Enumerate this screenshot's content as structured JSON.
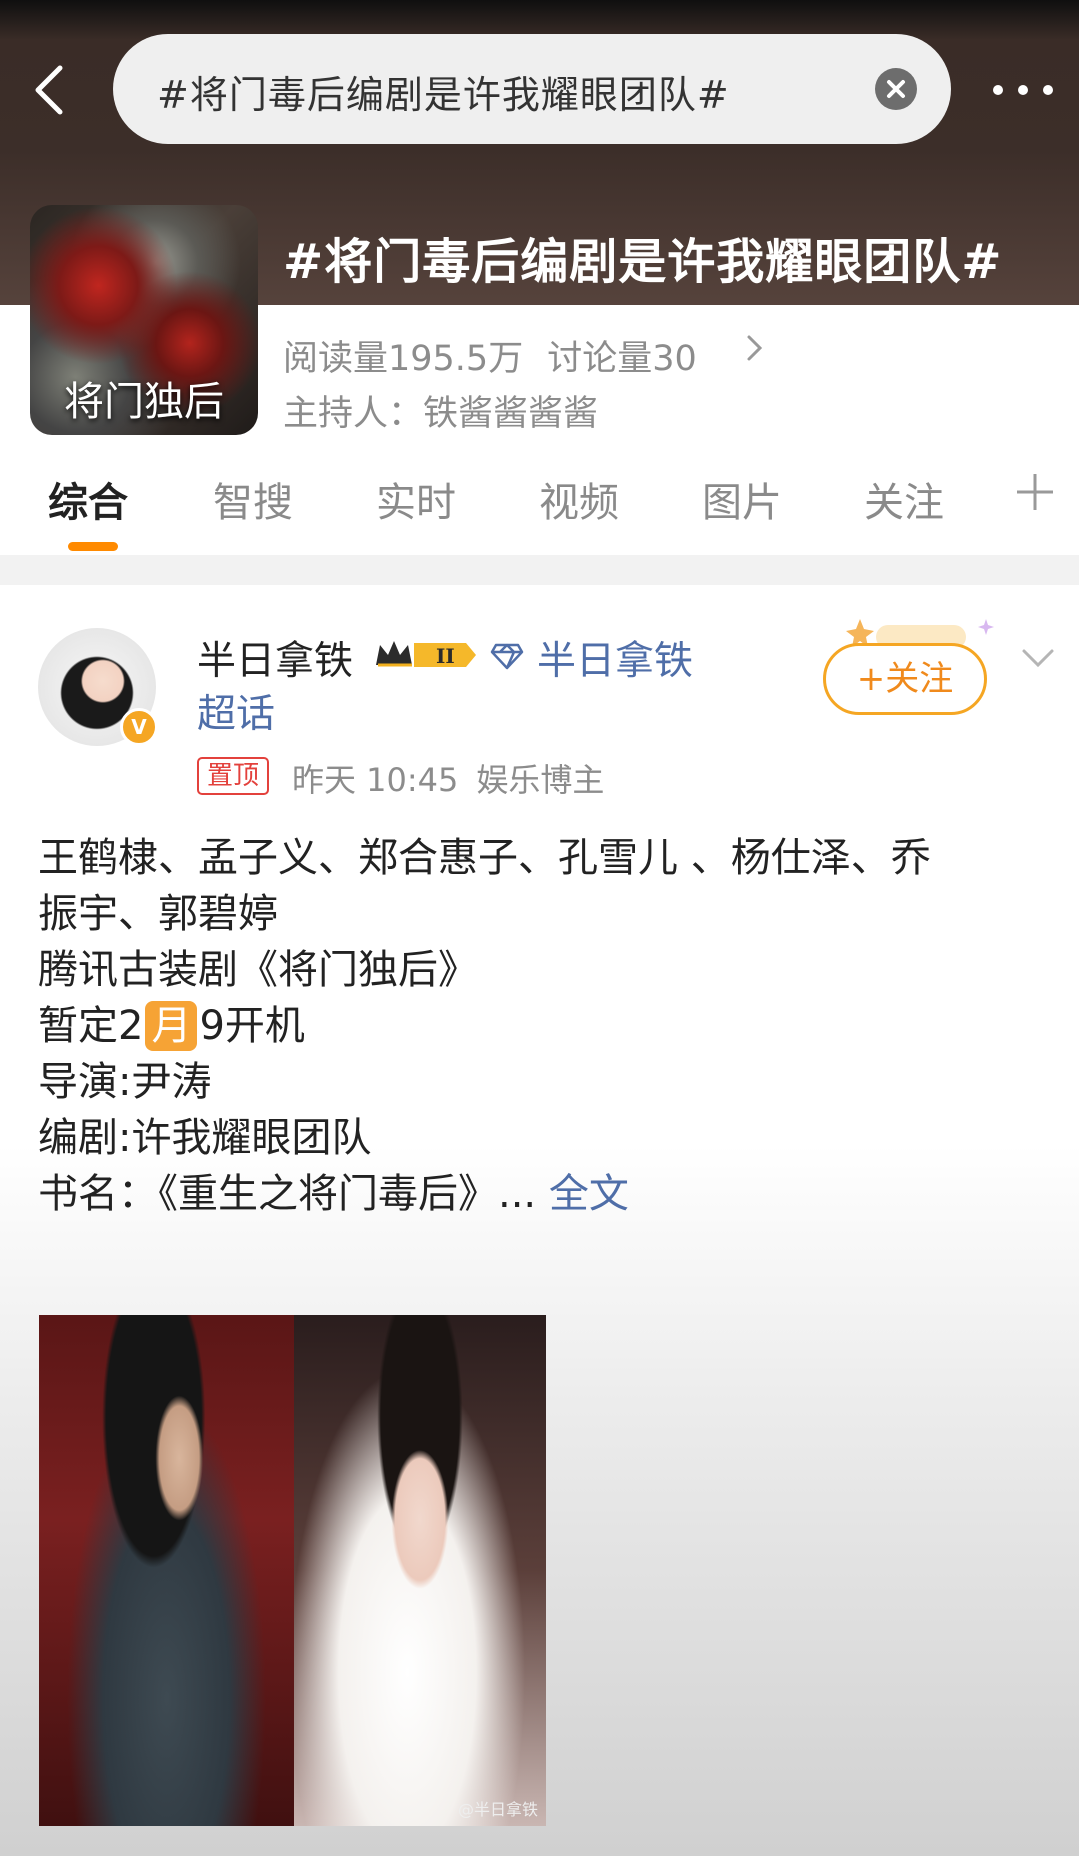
{
  "search": {
    "query": "#将门毒后编剧是许我耀眼团队#"
  },
  "topic": {
    "title": "#将门毒后编剧是许我耀眼团队#",
    "cover_title": "将门独后",
    "reads": "阅读量195.5万",
    "discussions": "讨论量30",
    "host": "主持人：铁酱酱酱酱"
  },
  "tabs": [
    {
      "label": "综合",
      "active": true
    },
    {
      "label": "智搜"
    },
    {
      "label": "实时"
    },
    {
      "label": "视频"
    },
    {
      "label": "图片"
    },
    {
      "label": "关注"
    }
  ],
  "post": {
    "username": "半日拿铁",
    "vip_level": "II",
    "superchat_line1": "半日拿铁",
    "superchat_line2": "超话",
    "pin_label": "置顶",
    "time": "昨天 10:45",
    "tag": "娱乐博主",
    "follow_label": "+关注",
    "lines": [
      "王鹤棣、孟子义、郑合惠子、孔雪儿 、杨仕泽、乔",
      "振宇、郭碧婷",
      "腾讯古装剧《将门独后》"
    ],
    "schedule_prefix": "暂定2",
    "schedule_month": "月",
    "schedule_suffix": "9开机",
    "director": "导演:尹涛",
    "writer": "编剧:许我耀眼团队",
    "book_prefix": "书名：《重生之将门毒后》... ",
    "full_text": "全文",
    "image_watermark": "@半日拿铁"
  },
  "colors": {
    "accent": "#ff8a00",
    "link": "#4f6ea8",
    "pin": "#e3413c",
    "follow": "#f5a623"
  }
}
